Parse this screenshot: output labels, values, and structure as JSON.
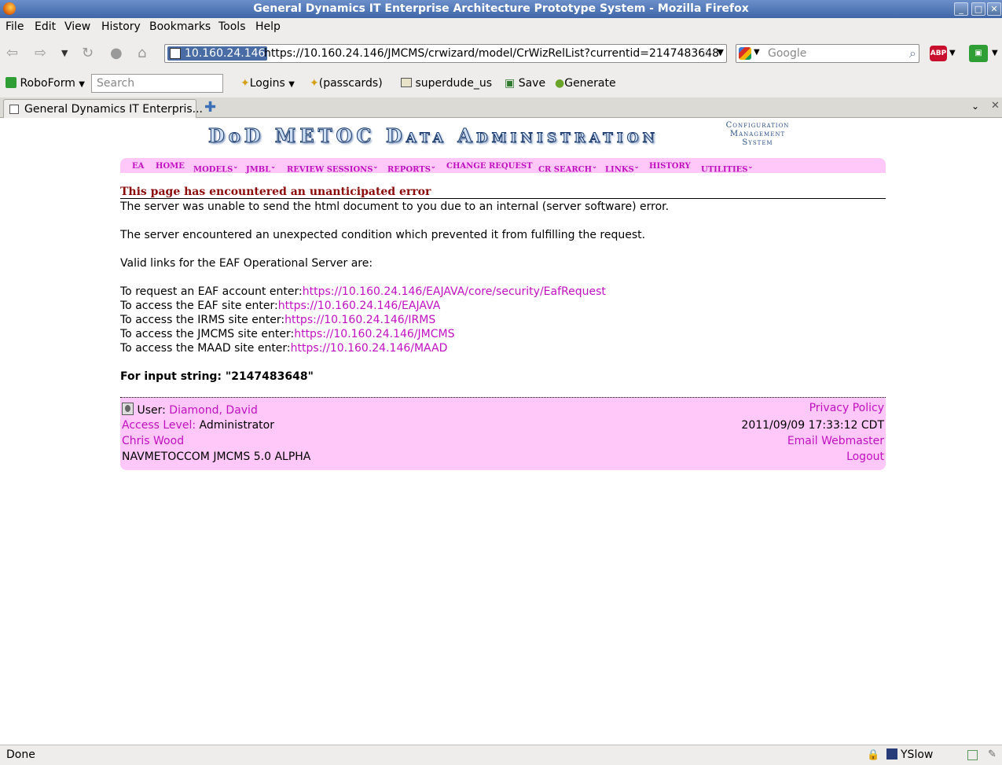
{
  "window": {
    "title": "General Dynamics IT Enterprise Architecture Prototype System - Mozilla Firefox",
    "min_glyph": "_",
    "max_glyph": "□",
    "close_glyph": "✕"
  },
  "menu": [
    "File",
    "Edit",
    "View",
    "History",
    "Bookmarks",
    "Tools",
    "Help"
  ],
  "navbar": {
    "site_identity": "10.160.24.146",
    "url": "https://10.160.24.146/JMCMS/crwizard/model/CrWizRelList?currentid=2147483648",
    "search_placeholder": "Google",
    "abp_label": "ABP"
  },
  "bookmarks": {
    "roboform": "RoboForm",
    "search_placeholder": "Search",
    "logins": "Logins",
    "passcards": "(passcards)",
    "user": "superdude_us",
    "save": "Save",
    "generate": "Generate"
  },
  "tab": {
    "label": "General Dynamics IT Enterpris..."
  },
  "page": {
    "banner": "DoD METOC Data Administration",
    "cms_line1": "Configuration",
    "cms_line2": "Management",
    "cms_line3": "System",
    "nav": [
      "EA",
      "HOME",
      "MODELS",
      "JMBL",
      "REVIEW SESSIONS",
      "REPORTS",
      "CHANGE REQUEST",
      "CR SEARCH",
      "LINKS",
      "HISTORY",
      "UTILITIES"
    ],
    "error_heading": "This page has encountered an unanticipated error",
    "p1": "The server was unable to send the html document to you due to an internal (server software) error.",
    "p2": "The server encountered an unexpected condition which prevented it from fulfilling the request.",
    "p3": "Valid links for the EAF Operational Server are:",
    "links": [
      {
        "label": "To request an EAF account enter:",
        "url": "https://10.160.24.146/EAJAVA/core/security/EafRequest"
      },
      {
        "label": "To access the EAF site enter:",
        "url": "https://10.160.24.146/EAJAVA"
      },
      {
        "label": "To access the IRMS site enter:",
        "url": "https://10.160.24.146/IRMS"
      },
      {
        "label": "To access the JMCMS site enter:",
        "url": "https://10.160.24.146/JMCMS"
      },
      {
        "label": "To access the MAAD site enter:",
        "url": "https://10.160.24.146/MAAD"
      }
    ],
    "input_string": "For input string: \"2147483648\""
  },
  "footer": {
    "user_label": "User:",
    "user_name": "Diamond, David",
    "access_label": "Access Level:",
    "access_value": "Administrator",
    "author": "Chris Wood",
    "version": "NAVMETOCCOM JMCMS 5.0 ALPHA",
    "privacy": "Privacy Policy",
    "timestamp": "2011/09/09 17:33:12 CDT",
    "webmaster": "Email Webmaster",
    "logout": "Logout"
  },
  "status": {
    "text": "Done",
    "yslow": "YSlow"
  },
  "colors": {
    "link": "#c010c0",
    "nav_bg": "#ffc8f8",
    "error_heading": "#8b0a0a"
  }
}
